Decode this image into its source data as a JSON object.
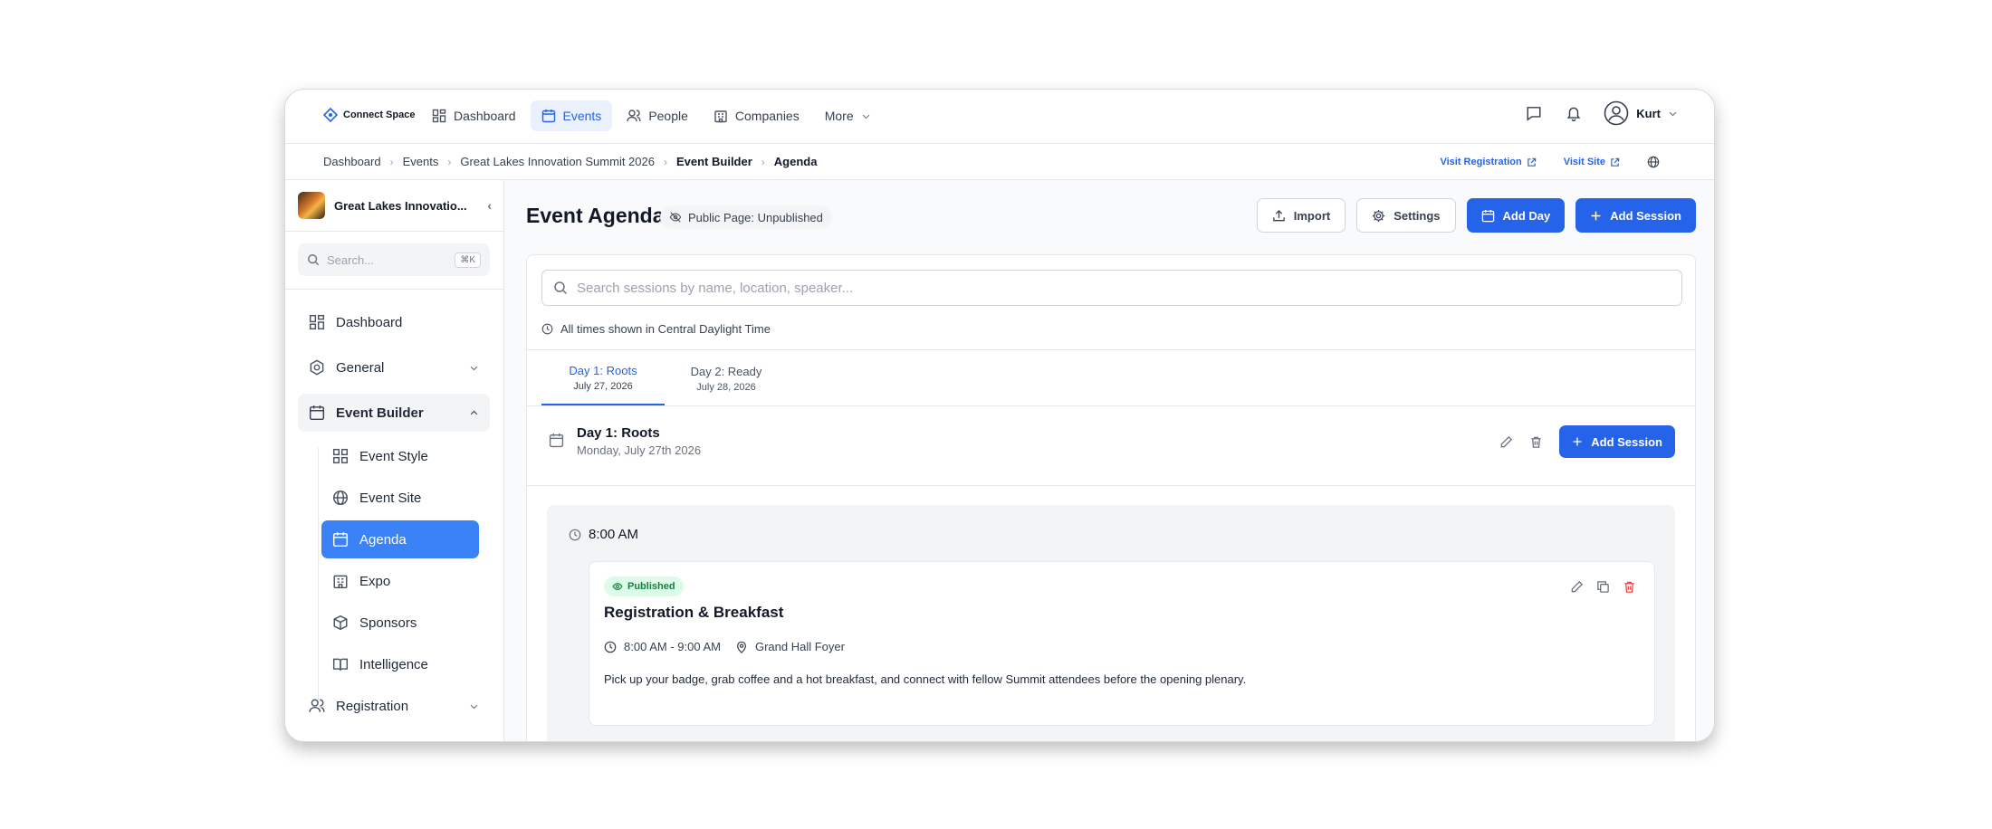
{
  "app": {
    "logo_text": "Connect Space"
  },
  "topnav": {
    "items": [
      {
        "label": "Dashboard",
        "icon": "grid-icon"
      },
      {
        "label": "Events",
        "icon": "calendar-icon"
      },
      {
        "label": "People",
        "icon": "users-icon"
      },
      {
        "label": "Companies",
        "icon": "building-icon"
      },
      {
        "label": "More",
        "icon": "chevron-down-icon"
      }
    ],
    "user": "Kurt"
  },
  "breadcrumb": {
    "items": [
      "Dashboard",
      "Events",
      "Great Lakes Innovation Summit 2026",
      "Event Builder",
      "Agenda"
    ],
    "visit_registration": "Visit Registration",
    "visit_site": "Visit Site"
  },
  "sidebar": {
    "event_name": "Great Lakes Innovatio...",
    "search_placeholder": "Search...",
    "shortcut": "⌘K",
    "items": [
      {
        "label": "Dashboard"
      },
      {
        "label": "General"
      },
      {
        "label": "Event Builder"
      },
      {
        "label": "Registration"
      }
    ],
    "sub_items": [
      {
        "label": "Event Style"
      },
      {
        "label": "Event Site"
      },
      {
        "label": "Agenda"
      },
      {
        "label": "Expo"
      },
      {
        "label": "Sponsors"
      },
      {
        "label": "Intelligence"
      }
    ]
  },
  "main": {
    "title": "Event Agenda",
    "public_badge": "Public Page: Unpublished",
    "actions": {
      "import": "Import",
      "settings": "Settings",
      "add_day": "Add Day",
      "add_session": "Add Session"
    },
    "search_placeholder": "Search sessions by name, location, speaker...",
    "timezone_note": "All times shown in Central Daylight Time",
    "tabs": [
      {
        "label": "Day 1: Roots",
        "date": "July 27, 2026"
      },
      {
        "label": "Day 2: Ready",
        "date": "July 28, 2026"
      }
    ],
    "day": {
      "title": "Day 1: Roots",
      "subtitle": "Monday, July 27th 2026",
      "add_session": "Add Session"
    },
    "time_slot": "8:00 AM",
    "session": {
      "status": "Published",
      "title": "Registration & Breakfast",
      "time": "8:00 AM - 9:00 AM",
      "location": "Grand Hall Foyer",
      "description": "Pick up your badge, grab coffee and a hot breakfast, and connect with fellow Summit attendees before the opening plenary."
    }
  },
  "colors": {
    "accent": "#2563eb",
    "accent_light": "#3b82f6",
    "published_bg": "#dcfce7",
    "published_text": "#15803d",
    "danger": "#ef4444"
  }
}
